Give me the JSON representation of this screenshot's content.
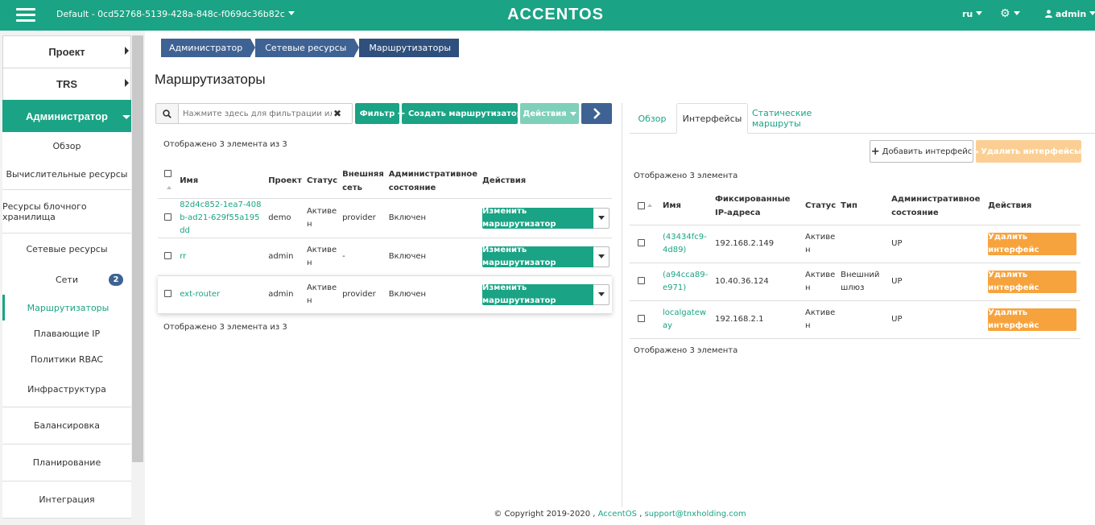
{
  "topbar": {
    "project": "Default - 0cd52768-5139-428a-848c-f069dc36b82c",
    "brand": "ACCENTOS",
    "language": "ru",
    "user": "admin"
  },
  "sidebar": {
    "top": [
      "Проект",
      "TRS",
      "Администратор"
    ],
    "items": [
      {
        "label": "Обзор"
      },
      {
        "label": "Вычислительные ресурсы"
      },
      {
        "label": "Ресурсы блочного хранилища"
      },
      {
        "label": "Сетевые ресурсы"
      },
      {
        "label": "Сети",
        "badge": "2"
      },
      {
        "label": "Маршрутизаторы"
      },
      {
        "label": "Плавающие IP"
      },
      {
        "label": "Политики RBAC"
      },
      {
        "label": "Инфраструктура"
      },
      {
        "label": "Балансировка"
      },
      {
        "label": "Планирование"
      },
      {
        "label": "Интеграция"
      }
    ]
  },
  "breadcrumb": [
    "Администратор",
    "Сетевые ресурсы",
    "Маршрутизаторы"
  ],
  "page_title": "Маршрутизаторы",
  "toolbar": {
    "search_placeholder": "Нажмите здесь для фильтрации или п...",
    "filter": "Фильтр",
    "create": "Создать маршрутизатор",
    "actions": "Действия"
  },
  "routers": {
    "summary": "Отображено 3 элемента из 3",
    "columns": [
      "Имя",
      "Проект",
      "Статус",
      "Внешняя сеть",
      "Административное состояние",
      "Действия"
    ],
    "rows": [
      {
        "name": "82d4c852-1ea7-408b-ad21-629f55a195dd",
        "project": "demo",
        "status": "Активен",
        "network": "provider",
        "admin_state": "Включен",
        "action": "Изменить маршрутизатор"
      },
      {
        "name": "rr",
        "project": "admin",
        "status": "Активен",
        "network": "-",
        "admin_state": "Включен",
        "action": "Изменить маршрутизатор"
      },
      {
        "name": "ext-router",
        "project": "admin",
        "status": "Активен",
        "network": "provider",
        "admin_state": "Включен",
        "action": "Изменить маршрутизатор"
      }
    ]
  },
  "detail": {
    "tabs": [
      "Обзор",
      "Интерфейсы",
      "Статические маршруты"
    ],
    "add_interface": "Добавить интерфейс",
    "delete_interfaces": "Удалить интерфейсы",
    "summary": "Отображено 3 элемента",
    "columns": [
      "Имя",
      "Фиксированные IP-адреса",
      "Статус",
      "Тип",
      "Административное состояние",
      "Действия"
    ],
    "rows": [
      {
        "name": "(43434fc9-4d89)",
        "ip": "192.168.2.149",
        "status": "Активен",
        "type": "",
        "admin_state": "UP",
        "action": "Удалить интерфейс"
      },
      {
        "name": "(a94cca89-e971)",
        "ip": "10.40.36.124",
        "status": "Активен",
        "type": "Внешний шлюз",
        "admin_state": "UP",
        "action": "Удалить интерфейс"
      },
      {
        "name": "localgateway",
        "ip": "192.168.2.1",
        "status": "Активен",
        "type": "",
        "admin_state": "UP",
        "action": "Удалить интерфейс"
      }
    ]
  },
  "footer": {
    "copyright": "© Copyright 2019-2020 ,",
    "link1": "AccentOS",
    "sep": ",",
    "link2": "support@tnxholding.com"
  },
  "colors": {
    "accent": "#1aa384",
    "breadcrumb": "#3e6293",
    "warning": "#f7a33d"
  }
}
